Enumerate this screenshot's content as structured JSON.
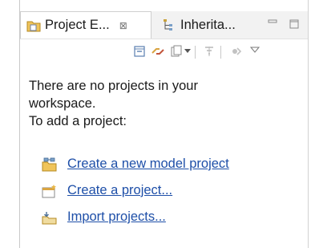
{
  "tabs": [
    {
      "label": "Project E...",
      "close_glyph": "⊠",
      "icon": "project-explorer-icon"
    },
    {
      "label": "Inherita...",
      "icon": "inheritance-icon"
    }
  ],
  "window_controls": [
    "minimize-icon",
    "maximize-icon"
  ],
  "toolbar": [
    "collapse-all-icon",
    "link-with-editor-icon",
    "view-menu-dropdown-icon",
    "filter-icon",
    "disabled-action-icon",
    "view-menu-icon"
  ],
  "message": {
    "line1": "There are no projects in your",
    "line2": "workspace.",
    "line3": "To add a project:"
  },
  "actions": [
    {
      "label": "Create a new model project",
      "icon": "new-model-project-icon"
    },
    {
      "label": "Create a project...",
      "icon": "new-project-icon"
    },
    {
      "label": "Import projects...",
      "icon": "import-projects-icon"
    }
  ],
  "colors": {
    "link": "#1e4fa8",
    "tab_bar": "#f2f2f2",
    "accent": "#d9a441"
  }
}
